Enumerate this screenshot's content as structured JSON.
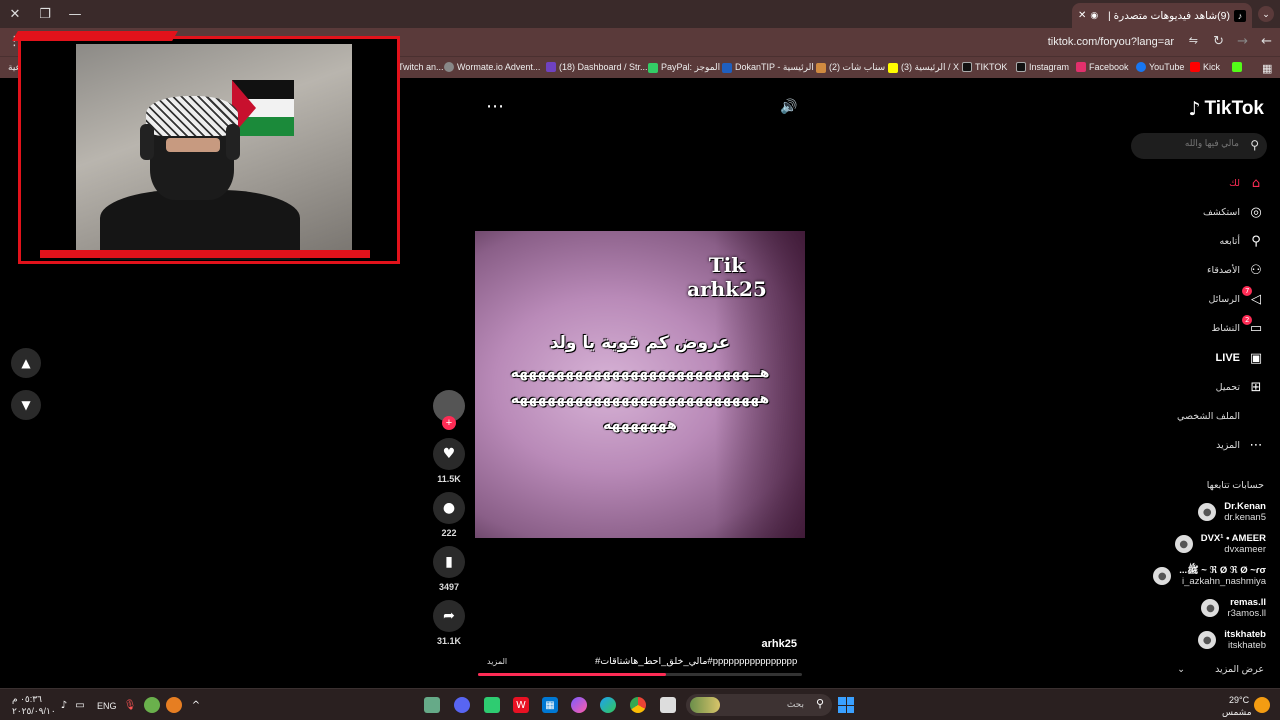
{
  "browser": {
    "tab_title": "(9)شاهد فيديوهات متصدرة |",
    "url": "tiktok.com/foryou?lang=ar",
    "bookmarks": [
      {
        "label": "Twitch an...",
        "color": "#9146ff"
      },
      {
        "label": "Wormate.io Advent...",
        "color": "#888888"
      },
      {
        "label": "(18) Dashboard / Str...",
        "color": "#6f42c1"
      },
      {
        "label": "PayPal: الموجز",
        "color": "#33cc66"
      },
      {
        "label": "DokanTIP - الرئيسية",
        "color": "#1f5fbf"
      },
      {
        "label": "(2) سناب شات",
        "color": "#d08a40"
      },
      {
        "label": "(3) الرئيسية / X",
        "color": "#fffc00"
      },
      {
        "label": "TIKTOK",
        "color": "#000000"
      },
      {
        "label": "Instagram",
        "color": "#000000"
      },
      {
        "label": "Facebook",
        "color": "#e1306c"
      },
      {
        "label": "YouTube",
        "color": "#1877f2"
      },
      {
        "label": "Kick",
        "color": "#ff0000"
      }
    ],
    "bookmark_cut_left": "عية"
  },
  "video": {
    "watermark_line1": "Tik",
    "watermark_line2": "arhk25",
    "overlay_line1": "عروض كم قوية يا ولد",
    "overlay_line2": "هــهههههههههههههههههههههههههه",
    "overlay_line3": "هههههههههههههههههههههههههههه",
    "overlay_line4": "هههههههه",
    "author": "arhk25",
    "caption": "#مالي_خلق_احط_هاشتاقات#pppppppppppppppp ...",
    "caption_more": "المزيد",
    "progress": 0.58
  },
  "actions": {
    "likes": "11.5K",
    "comments": "222",
    "saves": "3497",
    "shares": "31.1K"
  },
  "sidebar": {
    "logo": "TikTok",
    "search_placeholder": "مالي فيها والله",
    "nav": [
      {
        "label": "لك",
        "icon": "home-icon",
        "glyph": "⌂",
        "active": true
      },
      {
        "label": "استكشف",
        "icon": "compass-icon",
        "glyph": "◎"
      },
      {
        "label": "أتابعه",
        "icon": "user-plus-icon",
        "glyph": "⚲"
      },
      {
        "label": "الأصدقاء",
        "icon": "friends-icon",
        "glyph": "⚇"
      },
      {
        "label": "الرسائل",
        "icon": "messages-icon",
        "glyph": "◁",
        "badge": "7"
      },
      {
        "label": "النشاط",
        "icon": "activity-icon",
        "glyph": "▭",
        "badge": "2"
      },
      {
        "label": "LIVE",
        "icon": "live-icon",
        "glyph": "▣",
        "live": true
      },
      {
        "label": "تحميل",
        "icon": "upload-icon",
        "glyph": "⊞"
      },
      {
        "label": "الملف الشخصي",
        "icon": "profile-icon",
        "glyph": ""
      },
      {
        "label": "المزيد",
        "icon": "more-icon",
        "glyph": "⋯"
      }
    ],
    "following_title": "حسابات تتابعها",
    "accounts": [
      {
        "name": "Dr.Kenan",
        "handle": "dr.kenan5"
      },
      {
        "name": "DVX¹ • AMEER",
        "handle": "dvxameer"
      },
      {
        "name": "...ﷺ ~ ℜ Ø ℜ Ø ~ɾσ",
        "handle": "i_azkahn_nashmiya"
      },
      {
        "name": "remas.ll",
        "handle": "r3amos.ll"
      },
      {
        "name": "itskhateb",
        "handle": "itskhateb"
      }
    ],
    "see_more": "عرض المزيد"
  },
  "taskbar": {
    "temp": "29°C",
    "weather": "مشمس",
    "search_label": "بحث",
    "lang": "ENG",
    "time": "٠٥:٣٦ م",
    "date": "٢٠٢٥/٠٩/١٠"
  }
}
